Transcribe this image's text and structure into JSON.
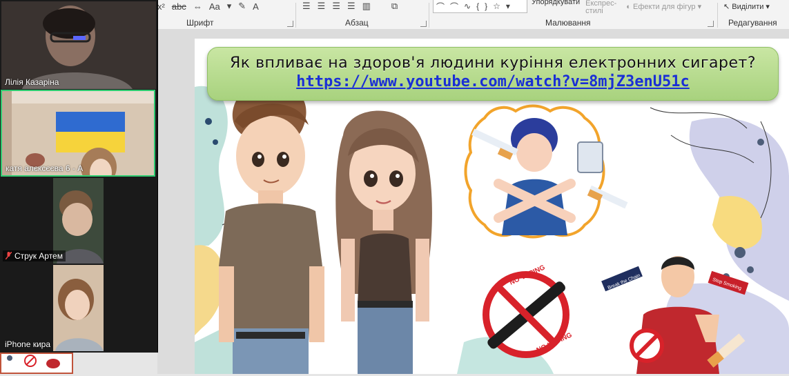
{
  "ribbon": {
    "groups": [
      {
        "label": "Шрифт"
      },
      {
        "label": "Абзац"
      },
      {
        "label": "Малювання"
      },
      {
        "label": "Редагування"
      }
    ],
    "arrange_label": "Упорядкувати",
    "quick_styles_label": "Експрес-",
    "quick_styles_label2": "стилі",
    "shape_effects_label": "Ефекти для фігур",
    "select_label": "Виділити",
    "font_case_label": "Aa"
  },
  "participants": [
    {
      "name": "Лілія Казаріна",
      "muted": false,
      "active": false
    },
    {
      "name": "катя алєксєєва 6 - А",
      "muted": false,
      "active": true
    },
    {
      "name": "Струк Артем",
      "muted": true,
      "active": false
    },
    {
      "name": "iPhone кира",
      "muted": false,
      "active": false
    }
  ],
  "slide": {
    "title": "Як впливає на здоров'я людини куріння електронних сигарет?",
    "link": "https://www.youtube.com/watch?v=8mjZ3enU51c",
    "sticker_chain": "Break the Chain",
    "sticker_stop": "Stop Smoking",
    "vaping_text_top": "NO VAPING",
    "vaping_text_bottom": "NO VAPING"
  },
  "colors": {
    "banner": "#b5db8d",
    "link": "#1a2fd6",
    "active_tile_border": "#2ecc71",
    "thumb_border": "#c0533a"
  }
}
